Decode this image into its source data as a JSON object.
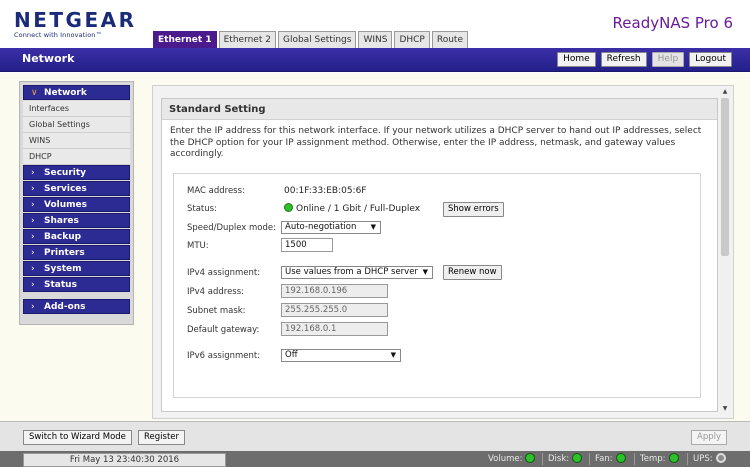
{
  "header": {
    "brand": "NETGEAR",
    "tagline": "Connect with Innovation™",
    "product": "ReadyNAS Pro 6",
    "tabs": [
      "Ethernet 1",
      "Ethernet 2",
      "Global Settings",
      "WINS",
      "DHCP",
      "Route"
    ]
  },
  "navbar": {
    "title": "Network",
    "buttons": [
      "Home",
      "Refresh",
      "Help",
      "Logout"
    ]
  },
  "sidebar": {
    "open_section": "Network",
    "sub_items": [
      "Interfaces",
      "Global Settings",
      "WINS",
      "DHCP"
    ],
    "sections": [
      "Security",
      "Services",
      "Volumes",
      "Shares",
      "Backup",
      "Printers",
      "System",
      "Status"
    ],
    "addons": "Add-ons"
  },
  "content": {
    "title": "Standard Setting",
    "description": "Enter the IP address for this network interface. If your network utilizes a DHCP server to hand out IP addresses, select the DHCP option for your IP assignment method. Otherwise, enter the IP address, netmask, and gateway values accordingly.",
    "mac_label": "MAC address:",
    "mac_value": "00:1F:33:EB:05:6F",
    "status_label": "Status:",
    "status_value": "Online / 1 Gbit / Full-Duplex",
    "show_errors": "Show errors",
    "speed_label": "Speed/Duplex mode:",
    "speed_value": "Auto-negotiation",
    "mtu_label": "MTU:",
    "mtu_value": "1500",
    "ipv4_assign_label": "IPv4 assignment:",
    "ipv4_assign_value": "Use values from a DHCP server",
    "renew_now": "Renew now",
    "ipv4_addr_label": "IPv4 address:",
    "ipv4_addr_value": "192.168.0.196",
    "subnet_label": "Subnet mask:",
    "subnet_value": "255.255.255.0",
    "gateway_label": "Default gateway:",
    "gateway_value": "192.168.0.1",
    "ipv6_assign_label": "IPv6 assignment:",
    "ipv6_assign_value": "Off"
  },
  "bottom": {
    "wizard": "Switch to Wizard Mode",
    "register": "Register",
    "apply": "Apply"
  },
  "status": {
    "datetime": "Fri May 13  23:40:30 2016",
    "volume": "Volume:",
    "disk": "Disk:",
    "fan": "Fan:",
    "temp": "Temp:",
    "ups": "UPS:"
  },
  "colors": {
    "accent": "#2c2a93",
    "active_tab": "#4b1a8c",
    "ok": "#2ec02a"
  }
}
